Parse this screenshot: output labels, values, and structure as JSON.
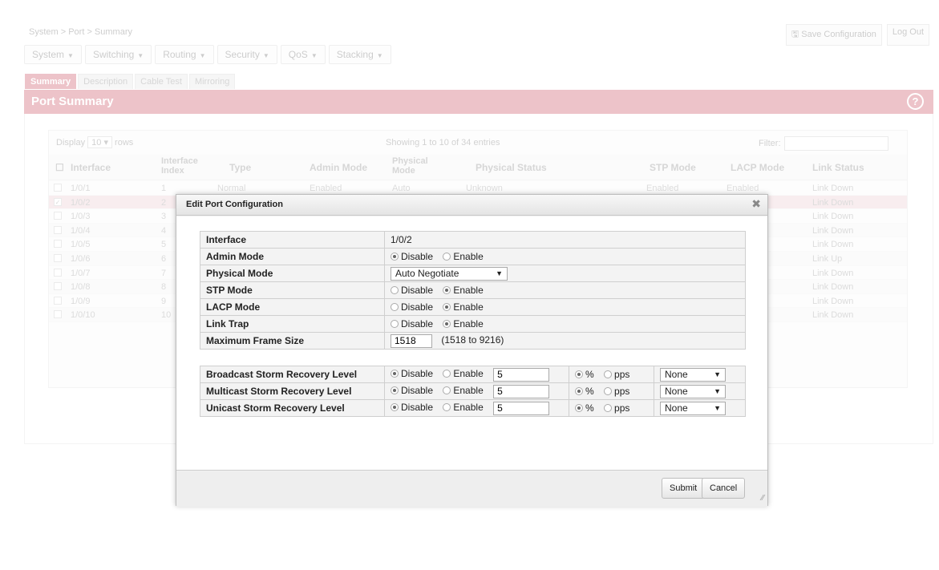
{
  "breadcrumb": "System > Port > Summary",
  "top_actions": {
    "save": "Save Configuration",
    "logout": "Log Out",
    "save_icon": "disk-icon"
  },
  "menu": [
    "System",
    "Switching",
    "Routing",
    "Security",
    "QoS",
    "Stacking"
  ],
  "tabs": [
    "Summary",
    "Description",
    "Cable Test",
    "Mirroring"
  ],
  "panel": {
    "title": "Port Summary",
    "help": "?"
  },
  "grid": {
    "display_label": "Display",
    "display_value": "10",
    "rows_label": "rows",
    "showing": "Showing 1 to 10 of 34 entries",
    "filter_label": "Filter:",
    "columns": [
      "Interface",
      "Interface Index",
      "Type",
      "Admin Mode",
      "Physical Mode",
      "Physical Status",
      "STP Mode",
      "LACP Mode",
      "Link Status"
    ],
    "rows": [
      {
        "iface": "1/0/1",
        "index": "1",
        "type": "Normal",
        "admin": "Enabled",
        "phys_mode": "Auto",
        "phys_status": "Unknown",
        "stp": "Enabled",
        "lacp": "Enabled",
        "link": "Link Down"
      },
      {
        "iface": "1/0/2",
        "index": "2",
        "link": "Link Down"
      },
      {
        "iface": "1/0/3",
        "index": "3",
        "link": "Link Down"
      },
      {
        "iface": "1/0/4",
        "index": "4",
        "link": "Link Down"
      },
      {
        "iface": "1/0/5",
        "index": "5",
        "link": "Link Down"
      },
      {
        "iface": "1/0/6",
        "index": "6",
        "link": "Link Up"
      },
      {
        "iface": "1/0/7",
        "index": "7",
        "link": "Link Down"
      },
      {
        "iface": "1/0/8",
        "index": "8",
        "link": "Link Down"
      },
      {
        "iface": "1/0/9",
        "index": "9",
        "link": "Link Down"
      },
      {
        "iface": "1/0/10",
        "index": "10",
        "link": "Link Down"
      }
    ]
  },
  "modal": {
    "title": "Edit Port Configuration",
    "close": "✖",
    "fields": {
      "interface": {
        "label": "Interface",
        "value": "1/0/2"
      },
      "admin_mode": {
        "label": "Admin Mode",
        "options": [
          "Disable",
          "Enable"
        ],
        "selected": 0
      },
      "physical_mode": {
        "label": "Physical Mode",
        "value": "Auto Negotiate"
      },
      "stp_mode": {
        "label": "STP Mode",
        "options": [
          "Disable",
          "Enable"
        ],
        "selected": 1
      },
      "lacp_mode": {
        "label": "LACP Mode",
        "options": [
          "Disable",
          "Enable"
        ],
        "selected": 1
      },
      "link_trap": {
        "label": "Link Trap",
        "options": [
          "Disable",
          "Enable"
        ],
        "selected": 1
      },
      "max_frame": {
        "label": "Maximum Frame Size",
        "value": "1518",
        "hint": "(1518 to 9216)"
      }
    },
    "storm": [
      {
        "label": "Broadcast Storm Recovery Level",
        "options": [
          "Disable",
          "Enable"
        ],
        "selected": 0,
        "value": "5",
        "units": [
          "%",
          "pps"
        ],
        "unit_selected": 0,
        "action": "None"
      },
      {
        "label": "Multicast Storm Recovery Level",
        "options": [
          "Disable",
          "Enable"
        ],
        "selected": 0,
        "value": "5",
        "units": [
          "%",
          "pps"
        ],
        "unit_selected": 0,
        "action": "None"
      },
      {
        "label": "Unicast Storm Recovery Level",
        "options": [
          "Disable",
          "Enable"
        ],
        "selected": 0,
        "value": "5",
        "units": [
          "%",
          "pps"
        ],
        "unit_selected": 0,
        "action": "None"
      }
    ],
    "buttons": {
      "submit": "Submit",
      "cancel": "Cancel"
    }
  }
}
